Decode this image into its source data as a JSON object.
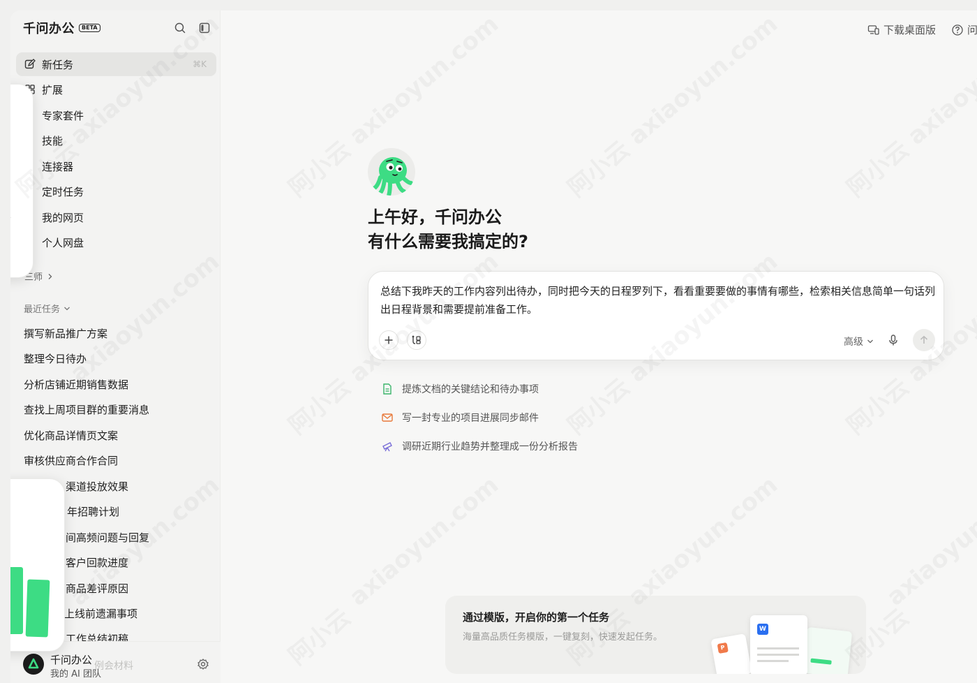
{
  "brand": {
    "name": "千问办公",
    "badge": "BETA"
  },
  "nav": {
    "items": [
      {
        "label": "新任务",
        "shortcut": "⌘K",
        "icon": "edit-icon"
      },
      {
        "label": "扩展",
        "icon": "extension-icon"
      },
      {
        "label": "专家套件"
      },
      {
        "label": "技能"
      },
      {
        "label": "连接器"
      },
      {
        "label": "定时任务"
      },
      {
        "label": "我的网页"
      },
      {
        "label": "个人网盘"
      }
    ],
    "more_label": "三师"
  },
  "recent": {
    "title": "最近任务",
    "tasks": [
      "撰写新品推广方案",
      "整理今日待办",
      "分析店铺近期销售数据",
      "查找上周项目群的重要消息",
      "优化商品详情页文案",
      "审核供应商合作合同",
      "渠道投放效果",
      "年招聘计划",
      "间高频问题与回复",
      "客户回款进度",
      "商品差评原因",
      "上线前遗漏事项",
      "工作总结初稿"
    ]
  },
  "user": {
    "name": "千问办公",
    "subtitle": "我的 AI 团队",
    "ghost": "例会材料"
  },
  "topbar": {
    "download_label": "下载桌面版",
    "help_label": "问"
  },
  "greeting": {
    "line1": "上午好，千问办公",
    "line2": "有什么需要我搞定的?"
  },
  "composer": {
    "text": "总结下我昨天的工作内容列出待办，同时把今天的日程罗列下，看看重要要做的事情有哪些，检索相关信息简单一句话列出日程背景和需要提前准备工作。",
    "mode_label": "高级"
  },
  "suggestions": [
    {
      "label": "提炼文档的关键结论和待办事项",
      "icon": "document-icon",
      "color": "#3bb56a"
    },
    {
      "label": "写一封专业的项目进展同步邮件",
      "icon": "mail-icon",
      "color": "#e8793a"
    },
    {
      "label": "调研近期行业趋势并整理成一份分析报告",
      "icon": "telescope-icon",
      "color": "#7a6fd8"
    }
  ],
  "template_card": {
    "title": "通过模版，开启你的第一个任务",
    "subtitle": "海量高品质任务模版，一键复刻，快速发起任务。",
    "word_badge": "W",
    "ppt_badge": "P"
  },
  "watermark": {
    "text": "axiaoyun.com",
    "cn": "阿小云"
  },
  "colors": {
    "accent_green": "#3ddc84",
    "sidebar_bg": "#f3f3f2",
    "page_bg": "#f7f7f6"
  }
}
